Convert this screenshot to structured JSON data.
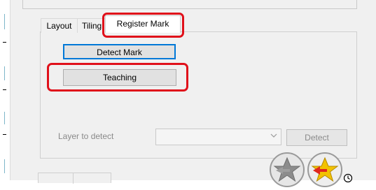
{
  "tabs": {
    "layout_label": "Layout",
    "tiling_label": "Tiling",
    "register_mark_label": "Register Mark"
  },
  "buttons": {
    "detect_mark_label": "Detect Mark",
    "teaching_label": "Teaching",
    "detect_label": "Detect"
  },
  "layer_row": {
    "label": "Layer to detect",
    "selected_value": ""
  },
  "icons": {
    "combo_arrow": "chevron-down-icon",
    "star_gray": "star-gray-icon",
    "star_gold": "star-gold-arrow-icon",
    "small_clock": "clock-icon"
  },
  "colors": {
    "highlight": "#e0101a",
    "focus_border": "#0078d7",
    "disabled_text": "#8a8a8a"
  }
}
